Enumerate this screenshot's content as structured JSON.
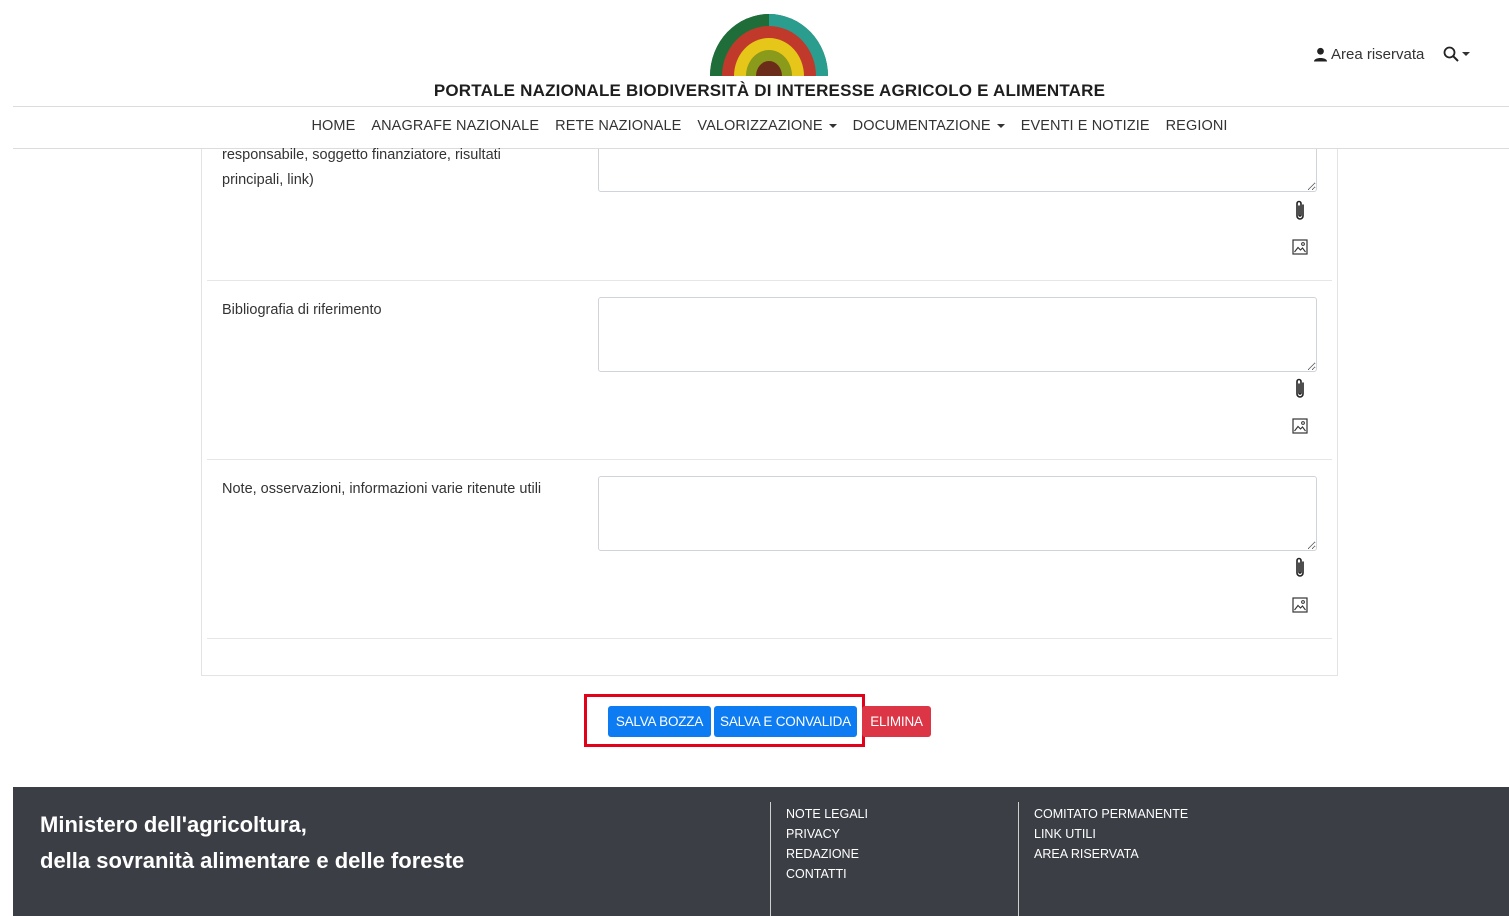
{
  "header": {
    "site_title": "PORTALE NAZIONALE BIODIVERSITÀ DI INTERESSE AGRICOLO E ALIMENTARE",
    "area_riservata": "Area riservata",
    "logo_colors": [
      "#1f6e3a",
      "#c0392b",
      "#e6c619",
      "#2a9d8f",
      "#6b2d1a"
    ]
  },
  "nav": {
    "items": [
      {
        "label": "HOME"
      },
      {
        "label": "ANAGRAFE NAZIONALE"
      },
      {
        "label": "RETE NAZIONALE"
      },
      {
        "label": "VALORIZZAZIONE"
      },
      {
        "label": "DOCUMENTAZIONE"
      },
      {
        "label": "EVENTI E NOTIZIE"
      },
      {
        "label": "REGIONI"
      }
    ]
  },
  "form": {
    "fields": [
      {
        "label": "responsabile, soggetto finanziatore, risultati principali, link)",
        "value": ""
      },
      {
        "label": "Bibliografia di riferimento",
        "value": ""
      },
      {
        "label": "Note, osservazioni, informazioni varie ritenute utili",
        "value": ""
      }
    ]
  },
  "buttons": {
    "salva_bozza": "SALVA BOZZA",
    "salva_convalida": "SALVA E CONVALIDA",
    "elimina": "ELIMINA"
  },
  "footer": {
    "ministry_line1": "Ministero dell'agricoltura,",
    "ministry_line2": "della sovranità alimentare e delle foreste",
    "col1": [
      "NOTE LEGALI",
      "PRIVACY",
      "REDAZIONE",
      "CONTATTI"
    ],
    "col2": [
      "COMITATO PERMANENTE",
      "LINK UTILI",
      "AREA RISERVATA"
    ]
  },
  "colors": {
    "primary_button": "#0d7cf2",
    "danger_button": "#dc3545",
    "highlight": "#e3001b",
    "footer_bg": "#3b3f45"
  },
  "icons": [
    "user-icon",
    "search-icon",
    "paperclip-icon",
    "image-icon"
  ]
}
